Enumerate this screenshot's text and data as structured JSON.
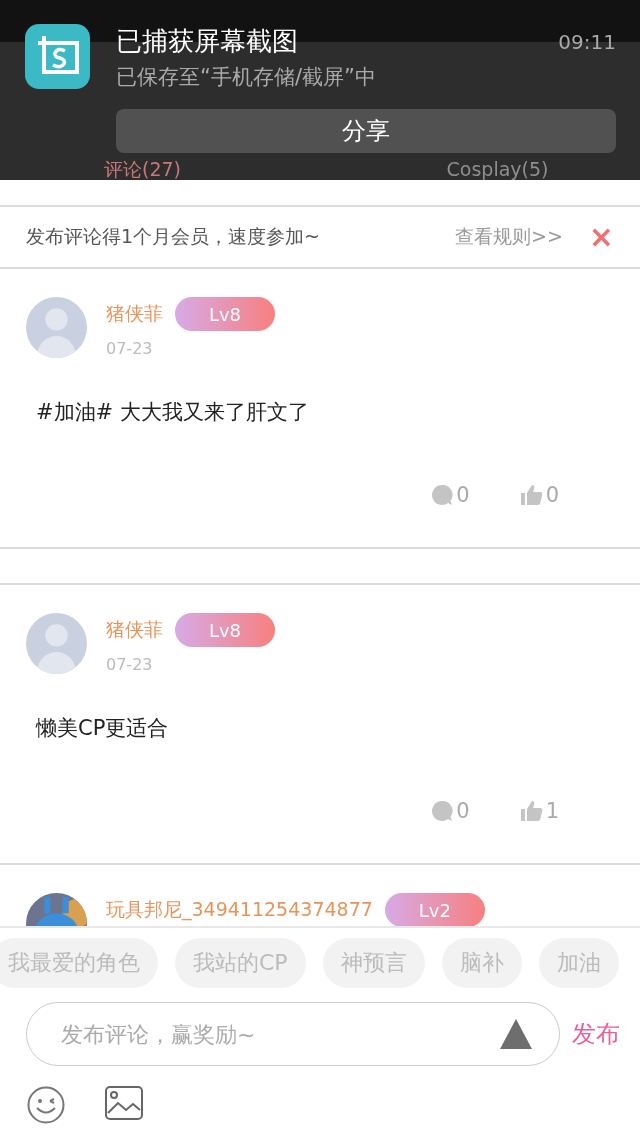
{
  "tabs": [
    {
      "label": "评论(27)",
      "selected": true
    },
    {
      "label": "Cosplay(5)",
      "selected": false
    }
  ],
  "notification": {
    "title": "已捕获屏幕截图",
    "subtitle": "已保存至“手机存储/截屏”中",
    "time": "09:11",
    "action": "分享"
  },
  "banner": {
    "text": "发布评论得1个月会员，速度参加~",
    "link": "查看规则>>",
    "close": "×"
  },
  "comments": [
    {
      "avatar": {
        "kind": "default"
      },
      "name": "猪侠菲",
      "level": "Lv8",
      "date": "07-23",
      "text": "#加油# 大大我又来了肝文了",
      "replies": "0",
      "likes": "0"
    },
    {
      "avatar": {
        "kind": "default"
      },
      "name": "猪侠菲",
      "level": "Lv8",
      "date": "07-23",
      "text": "懒美CP更适合",
      "replies": "0",
      "likes": "1"
    },
    {
      "name": "玩具邦尼_349411254374877",
      "level": "Lv2"
    }
  ],
  "topic_chips": [
    "我最爱的角色",
    "我站的CP",
    "神预言",
    "脑补",
    "加油"
  ],
  "composer": {
    "placeholder": "发布评论，赢奖励~",
    "submit": "发布"
  }
}
